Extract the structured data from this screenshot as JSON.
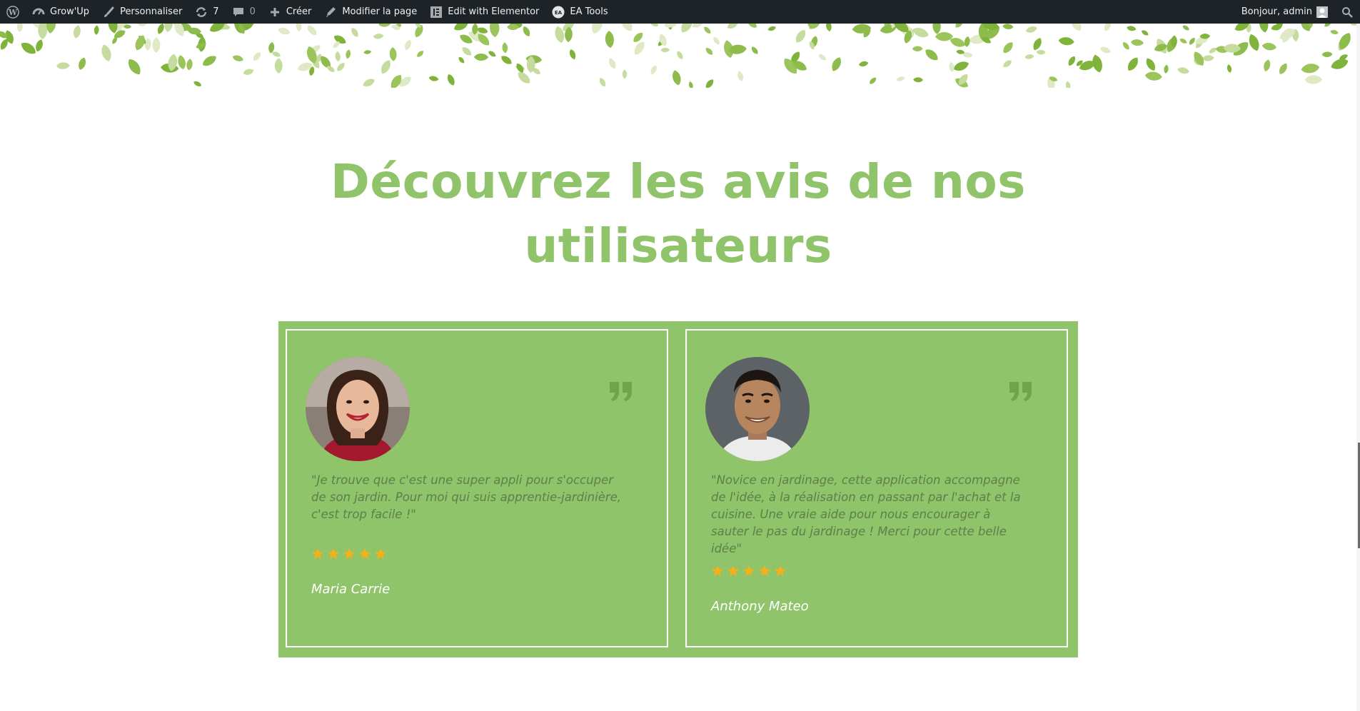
{
  "admin_bar": {
    "items_left": [
      {
        "icon": "wordpress-logo-icon",
        "label": ""
      },
      {
        "icon": "dashboard-icon",
        "label": "Grow'Up"
      },
      {
        "icon": "paintbrush-icon",
        "label": "Personnaliser"
      },
      {
        "icon": "updates-icon",
        "label": "7"
      },
      {
        "icon": "comments-icon",
        "label": "0"
      },
      {
        "icon": "plus-icon",
        "label": "Créer"
      },
      {
        "icon": "pencil-icon",
        "label": "Modifier la page"
      },
      {
        "icon": "elementor-icon",
        "label": "Edit with Elementor"
      },
      {
        "icon": "ea-icon",
        "label": "EA Tools"
      }
    ],
    "greeting": "Bonjour, admin",
    "search_icon": "search-icon"
  },
  "main": {
    "heading": "Découvrez les avis de nos utilisateurs",
    "accent_color": "#8fc46a",
    "testimonials": [
      {
        "quote": "\"Je trouve que c'est une super appli pour s'occuper de son jardin. Pour moi qui suis apprentie-jardinière, c'est trop facile !\"",
        "rating": 5,
        "author": "Maria Carrie"
      },
      {
        "quote": "\"Novice en jardinage, cette application accompagne de l'idée, à la réalisation en passant par l'achat et la cuisine. Une vraie aide pour nous encourager à sauter le pas du jardinage ! Merci pour cette belle idée\"",
        "rating": 5,
        "author": "Anthony Mateo"
      }
    ],
    "star_color": "#f5b01a"
  }
}
